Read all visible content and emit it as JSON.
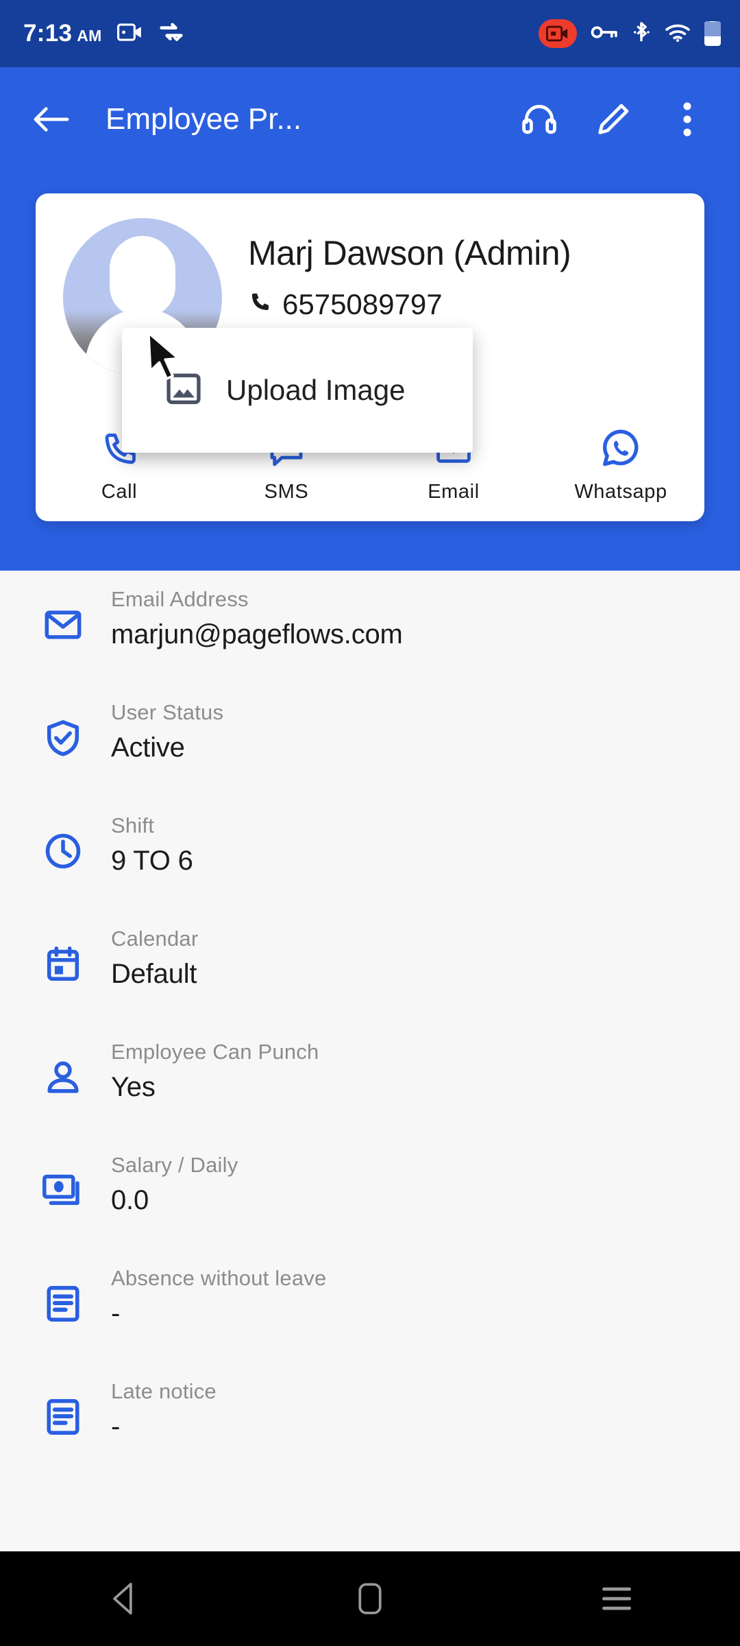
{
  "status_bar": {
    "time": "7:13",
    "am_pm": "AM",
    "icons": [
      "screen-record-icon",
      "sync-transfer-icon",
      "screen-record-badge-icon",
      "vpn-key-icon",
      "bluetooth-icon",
      "wifi-icon",
      "battery-icon"
    ]
  },
  "app_bar": {
    "back_label": "back-arrow",
    "title": "Employee Pr...",
    "actions": [
      "headset-support-icon",
      "edit-pencil-icon",
      "overflow-menu-icon"
    ]
  },
  "profile": {
    "name": "Marj Dawson (Admin)",
    "phone": "6575089797",
    "avatar_alt": "default-user-avatar",
    "actions": [
      {
        "label": "Call",
        "icon": "phone-icon"
      },
      {
        "label": "SMS",
        "icon": "sms-icon"
      },
      {
        "label": "Email",
        "icon": "email-icon"
      },
      {
        "label": "Whatsapp",
        "icon": "whatsapp-icon"
      }
    ]
  },
  "popup": {
    "item_label": "Upload Image",
    "item_icon": "image-icon"
  },
  "details": [
    {
      "label": "Email Address",
      "value": "marjun@pageflows.com",
      "icon": "envelope-icon"
    },
    {
      "label": "User Status",
      "value": "Active",
      "icon": "shield-check-icon"
    },
    {
      "label": "Shift",
      "value": "9 TO 6",
      "icon": "clock-icon"
    },
    {
      "label": "Calendar",
      "value": "Default",
      "icon": "calendar-icon"
    },
    {
      "label": "Employee Can Punch",
      "value": "Yes",
      "icon": "person-icon"
    },
    {
      "label": "Salary / Daily",
      "value": "0.0",
      "icon": "money-icon"
    },
    {
      "label": "Absence without leave",
      "value": "-",
      "icon": "article-icon"
    },
    {
      "label": "Late notice",
      "value": "-",
      "icon": "article-icon"
    }
  ],
  "nav_bar": {
    "back": "nav-back-icon",
    "home": "nav-home-icon",
    "recents": "nav-recents-icon"
  },
  "colors": {
    "status_bar": "#153f9b",
    "app_bar": "#2a5fe0",
    "accent": "#2a5fe0",
    "record_red": "#ee3c2c",
    "page_bg": "#f7f7f8",
    "label_gray": "#8c8c8c"
  }
}
